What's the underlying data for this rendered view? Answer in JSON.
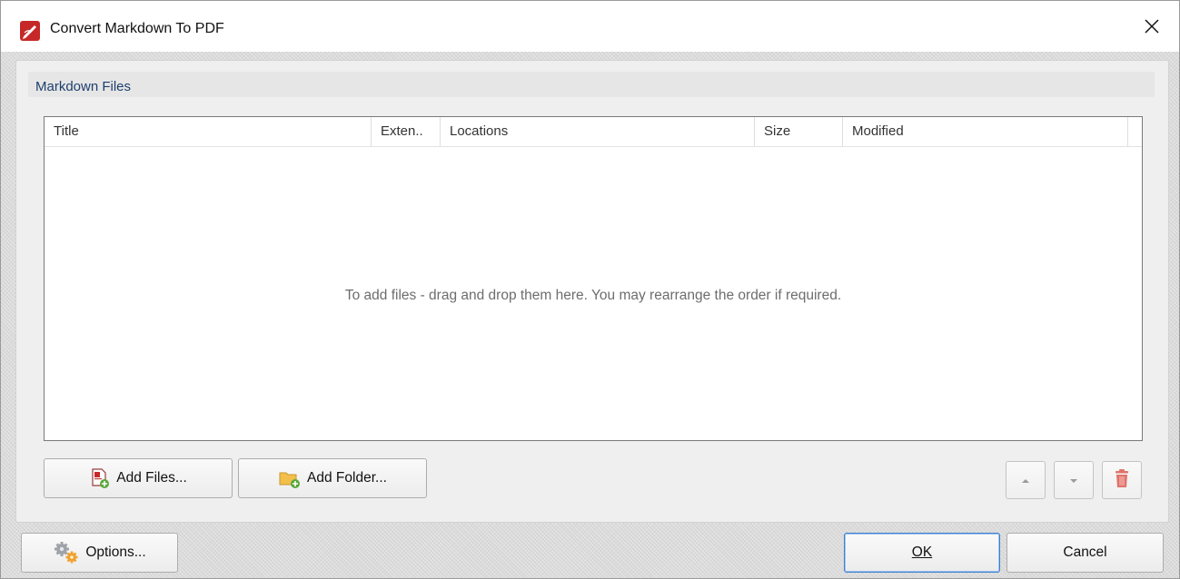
{
  "window": {
    "title": "Convert Markdown To PDF",
    "app_icon": "pdf-pen-icon",
    "close_icon": "close-icon"
  },
  "group": {
    "title": "Markdown Files"
  },
  "list": {
    "columns": [
      "Title",
      "Exten..",
      "Locations",
      "Size",
      "Modified"
    ],
    "rows": [],
    "empty_hint": "To add files - drag and drop them here. You may rearrange the order if required."
  },
  "actions": {
    "add_files_label": "Add Files...",
    "add_folder_label": "Add Folder...",
    "add_files_icon": "add-file-icon",
    "add_folder_icon": "add-folder-icon",
    "move_up_icon": "arrow-up-icon",
    "move_down_icon": "arrow-down-icon",
    "delete_icon": "trash-icon"
  },
  "footer": {
    "options_label": "Options...",
    "options_icon": "gears-icon",
    "ok_label": "OK",
    "cancel_label": "Cancel"
  },
  "colors": {
    "accent": "#3c7fd1",
    "group_title": "#1e3f6e",
    "delete_icon": "#e0736a",
    "brand_red": "#c62828"
  }
}
